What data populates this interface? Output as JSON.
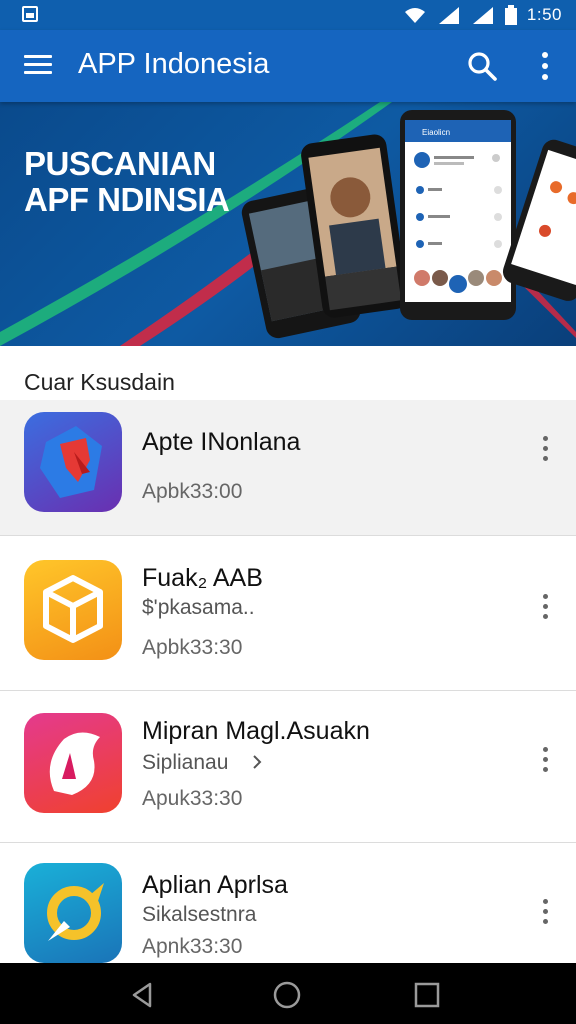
{
  "status_bar": {
    "time": "1:50",
    "icons": [
      "notification-icon",
      "wifi-icon",
      "signal-icon",
      "signal-icon",
      "battery-icon"
    ]
  },
  "app_bar": {
    "title": "APP Indonesia",
    "icons": [
      "menu-icon",
      "search-icon",
      "more-vert-icon"
    ]
  },
  "banner": {
    "headline_line1": "PUSCANIAN",
    "headline_line2": "APF NDINSIA",
    "phone_header": "Eiaolicn"
  },
  "section": {
    "title": "Cuar Ksusdain"
  },
  "apps": [
    {
      "name": "Apte INonlana",
      "subtitle": "",
      "meta": "Apbk33:00",
      "icon": "shield-app-icon",
      "color": "#5b3fb5"
    },
    {
      "name": "Fuak₂ AAB",
      "subtitle": "$'pkasama..",
      "meta": "Apbk33:30",
      "icon": "box-app-icon",
      "color": "#f7a21b"
    },
    {
      "name": "Mipran Magl.Asuakn",
      "subtitle": "Siplianau",
      "meta": "Apuk33:30",
      "icon": "flame-app-icon",
      "color": "#e8344a"
    },
    {
      "name": "Aplian Aprlsa",
      "subtitle": "Sikalsestnra",
      "meta": "Apnk33:30",
      "icon": "compass-app-icon",
      "color": "#1aa1c9"
    }
  ],
  "nav": [
    "back-icon",
    "home-icon",
    "recents-icon"
  ]
}
